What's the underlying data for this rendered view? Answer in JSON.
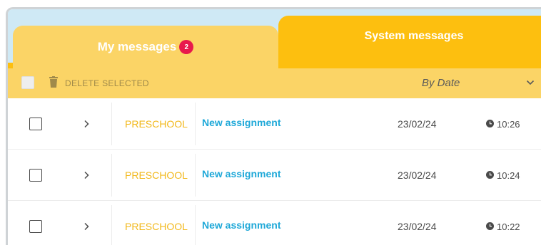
{
  "tabs": {
    "my_messages": {
      "label": "My messages",
      "badge": "2"
    },
    "system_messages": {
      "label": "System messages"
    }
  },
  "toolbar": {
    "delete_label": "DELETE SELECTED",
    "sort_label": "By Date"
  },
  "messages": [
    {
      "category": "PRESCHOOL",
      "subject": "New assignment",
      "date": "23/02/24",
      "time": "10:26"
    },
    {
      "category": "PRESCHOOL",
      "subject": "New assignment",
      "date": "23/02/24",
      "time": "10:24"
    },
    {
      "category": "PRESCHOOL",
      "subject": "New assignment",
      "date": "23/02/24",
      "time": "10:22"
    }
  ],
  "icons": {
    "trash": "trash-icon",
    "chevron_down": "chevron-down-icon",
    "chevron_right": "chevron-right-icon",
    "clock": "clock-icon"
  },
  "colors": {
    "tab_inactive": "#fbd466",
    "tab_active": "#fdbf0f",
    "badge": "#e8194c",
    "category": "#f2b81a",
    "subject": "#1ea8d8"
  }
}
